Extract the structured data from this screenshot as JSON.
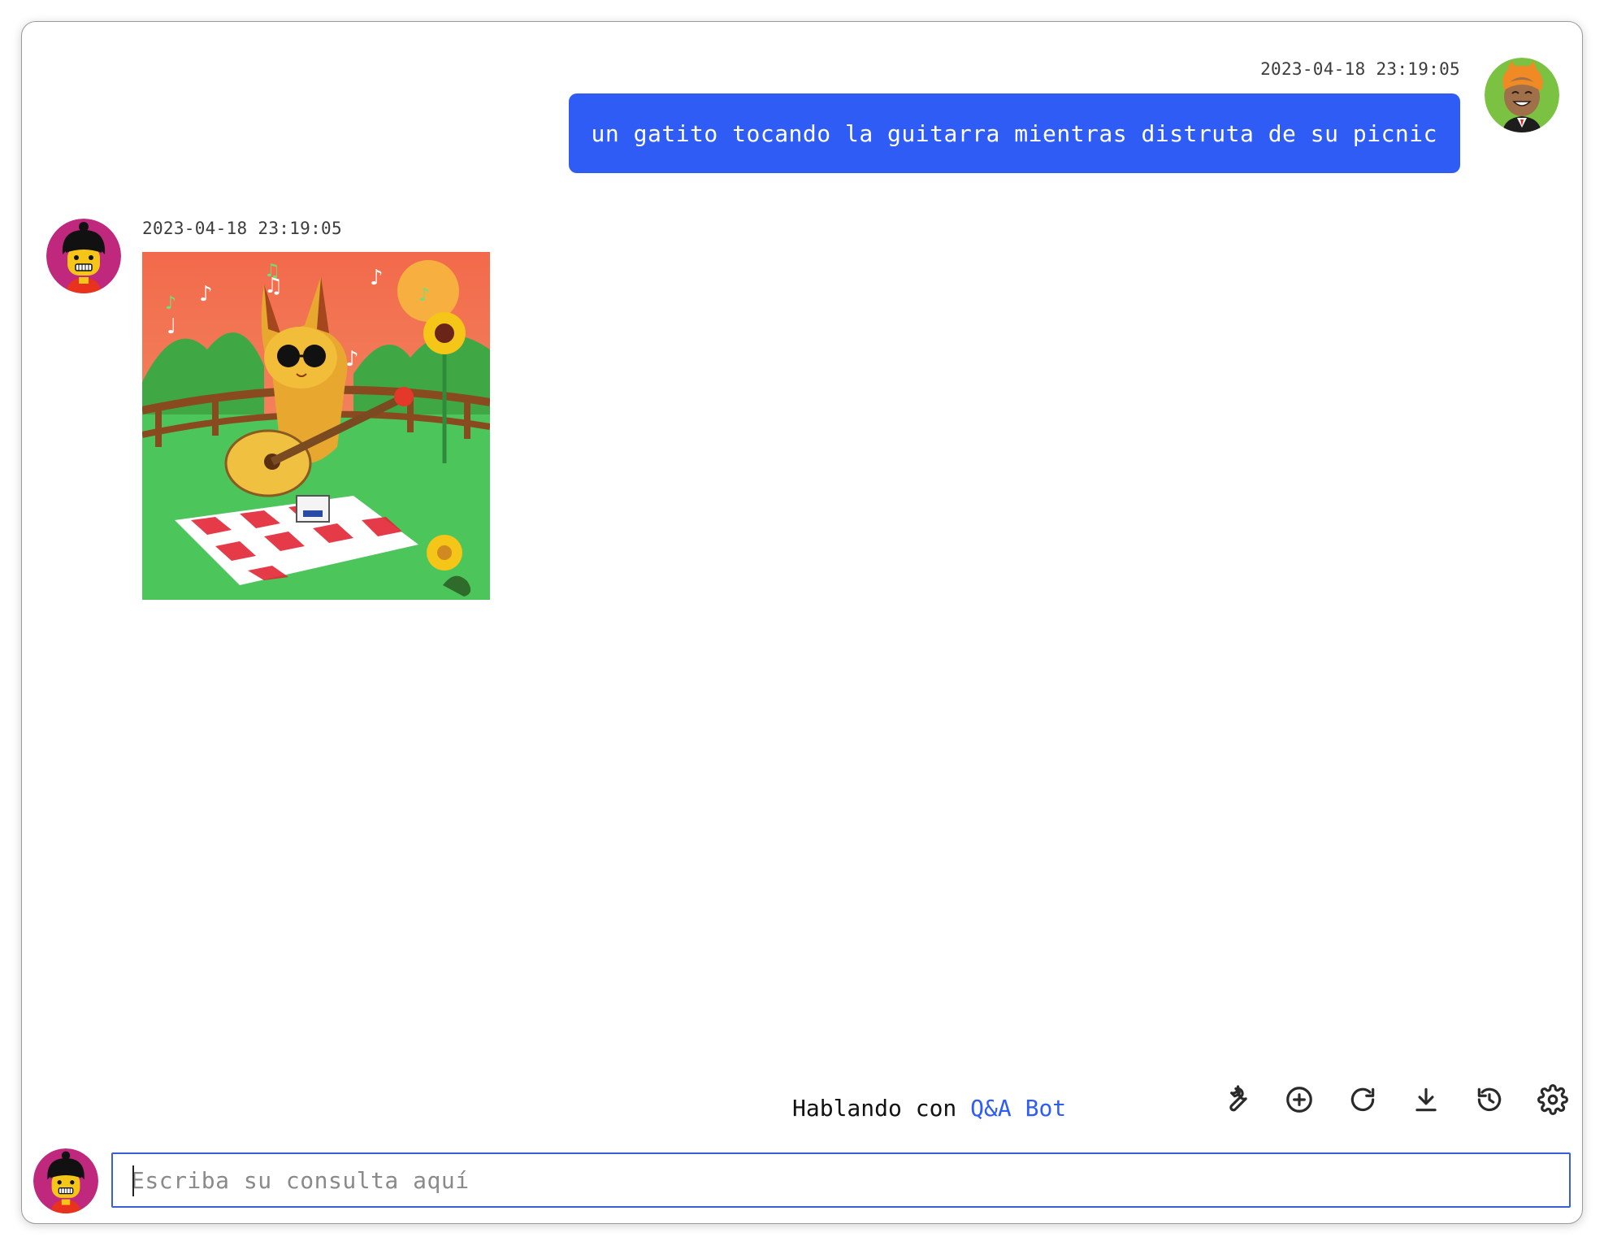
{
  "conversation": {
    "user_message": {
      "timestamp": "2023-04-18 23:19:05",
      "text": "un gatito tocando la guitarra mientras distruta de su picnic"
    },
    "bot_message": {
      "timestamp": "2023-04-18 23:19:05"
    }
  },
  "status": {
    "prefix": "Hablando con",
    "bot_name": "Q&A Bot"
  },
  "toolbar": {
    "icons": [
      "wrench-icon",
      "add-circle-icon",
      "refresh-icon",
      "download-icon",
      "history-icon",
      "gear-icon"
    ]
  },
  "input": {
    "placeholder": "Escriba su consulta aquí",
    "value": ""
  },
  "colors": {
    "accent": "#2f5cf5",
    "input_border": "#3a5ed8"
  }
}
